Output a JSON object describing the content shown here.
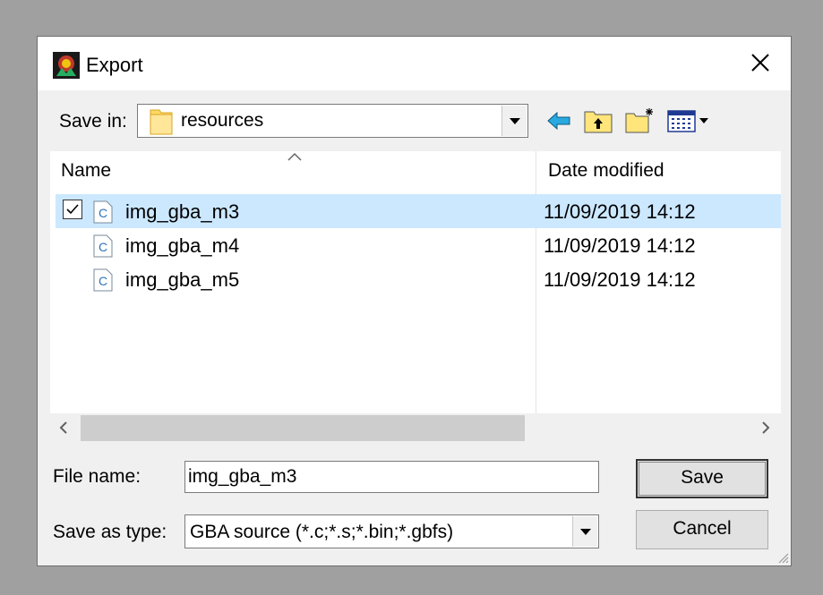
{
  "dialog": {
    "title": "Export",
    "save_in_label": "Save in:",
    "current_folder": "resources",
    "toolbar_icons": [
      "back-arrow-icon",
      "up-folder-icon",
      "new-folder-icon",
      "view-menu-icon"
    ]
  },
  "file_list": {
    "columns": [
      "Name",
      "Date modified"
    ],
    "sort_column": "Name",
    "rows": [
      {
        "name": "img_gba_m3",
        "date": "11/09/2019 14:12",
        "selected": true,
        "icon": "c-source-file-icon"
      },
      {
        "name": "img_gba_m4",
        "date": "11/09/2019 14:12",
        "selected": false,
        "icon": "c-source-file-icon"
      },
      {
        "name": "img_gba_m5",
        "date": "11/09/2019 14:12",
        "selected": false,
        "icon": "c-source-file-icon"
      }
    ]
  },
  "form": {
    "file_name_label": "File name:",
    "file_name_value": "img_gba_m3",
    "save_type_label": "Save as type:",
    "save_type_value": "GBA source (*.c;*.s;*.bin;*.gbfs)"
  },
  "buttons": {
    "save": "Save",
    "cancel": "Cancel"
  },
  "colors": {
    "selection": "#cce8ff",
    "folder": "#ffd966",
    "back_arrow": "#29a9e0"
  }
}
